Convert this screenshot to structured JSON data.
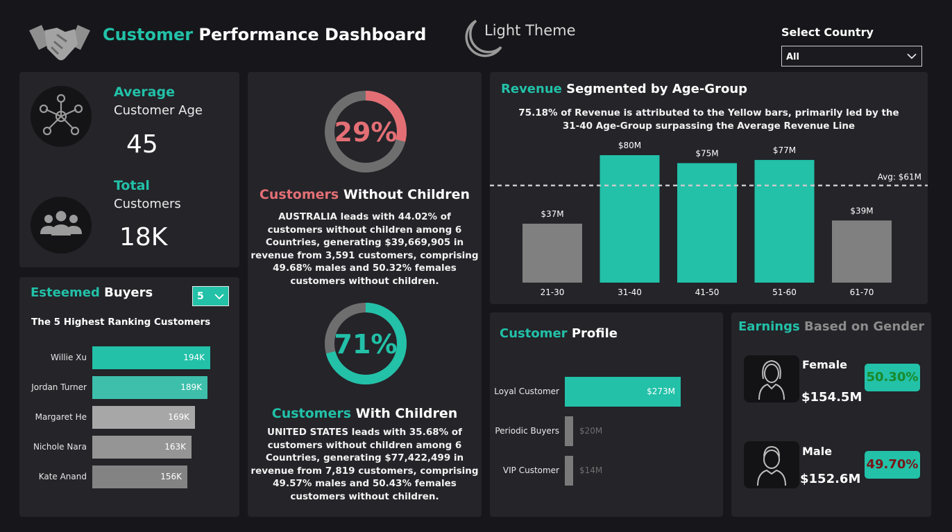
{
  "header": {
    "title_highlight": "Customer",
    "title_rest": " Performance Dashboard",
    "theme_label": "Light Theme",
    "country_label": "Select Country",
    "country_value": "All"
  },
  "kpis": {
    "age": {
      "line1": "Average",
      "line2": "Customer Age",
      "value": "45"
    },
    "total": {
      "line1": "Total",
      "line2": "Customers",
      "value": "18K"
    }
  },
  "buyers": {
    "title_highlight": "Esteemed",
    "title_rest": " Buyers",
    "dropdown_value": "5",
    "subtitle": "The 5 Highest Ranking Customers",
    "items": [
      {
        "name": "Willie Xu",
        "value": 194,
        "label": "194K",
        "color": "#22c1a8"
      },
      {
        "name": "Jordan Turner",
        "value": 189,
        "label": "189K",
        "color": "#3dbfab"
      },
      {
        "name": "Margaret He",
        "value": 169,
        "label": "169K",
        "color": "#a7a7a7"
      },
      {
        "name": "Nichole Nara",
        "value": 163,
        "label": "163K",
        "color": "#959595"
      },
      {
        "name": "Kate Anand",
        "value": 156,
        "label": "156K",
        "color": "#838383"
      }
    ]
  },
  "donuts": {
    "without": {
      "percent": 29,
      "label": "29%",
      "color": "#e36f75",
      "title_highlight": "Customers",
      "title_rest": " Without Children",
      "text": "AUSTRALIA leads with 44.02% of customers without children among 6 Countries, generating $39,669,905 in revenue from 3,591 customers, comprising 49.68% males and 50.32% females customers without children."
    },
    "with": {
      "percent": 71,
      "label": "71%",
      "color": "#22c1a8",
      "title_highlight": "Customers",
      "title_rest": " With Children",
      "text": "UNITED STATES leads with 35.68% of customers without children among 6 Countries, generating $77,422,499 in revenue from 7,819 customers, comprising 49.57% males and 50.43% females customers without children."
    }
  },
  "revenue": {
    "title_highlight": "Revenue",
    "title_rest": " Segmented by Age-Group",
    "subtitle": "75.18% of Revenue is attributed to the Yellow bars, primarily led by the 31-40 Age-Group surpassing the Average Revenue Line",
    "avg_label": "Avg: $61M"
  },
  "profile": {
    "title_highlight": "Customer",
    "title_rest": " Profile",
    "items": [
      {
        "name": "Loyal Customer",
        "value": 273,
        "label": "$273M",
        "color": "#22c1a8",
        "label_inside": true
      },
      {
        "name": "Periodic Buyers",
        "value": 20,
        "label": "$20M",
        "color": "#7a7a7a",
        "label_inside": false
      },
      {
        "name": "VIP Customer",
        "value": 14,
        "label": "$14M",
        "color": "#7a7a7a",
        "label_inside": false
      }
    ]
  },
  "gender": {
    "title_highlight": "Earnings",
    "title_rest": " Based on Gender",
    "female": {
      "name": "Female",
      "amount": "$154.5M",
      "pct": "50.30%",
      "pct_color": "#1a8a2a"
    },
    "male": {
      "name": "Male",
      "amount": "$152.6M",
      "pct": "49.70%",
      "pct_color": "#7a1518"
    }
  },
  "chart_data": {
    "type": "bar",
    "title": "Revenue Segmented by Age-Group",
    "categories": [
      "21-30",
      "31-40",
      "41-50",
      "51-60",
      "61-70"
    ],
    "values": [
      37,
      80,
      75,
      77,
      39
    ],
    "value_labels": [
      "$37M",
      "$80M",
      "$75M",
      "$77M",
      "$39M"
    ],
    "highlight": [
      false,
      true,
      true,
      true,
      false
    ],
    "colors": {
      "highlight": "#22c1a8",
      "normal": "#808080"
    },
    "average": 61,
    "ylim": [
      0,
      80
    ],
    "grid": false
  }
}
